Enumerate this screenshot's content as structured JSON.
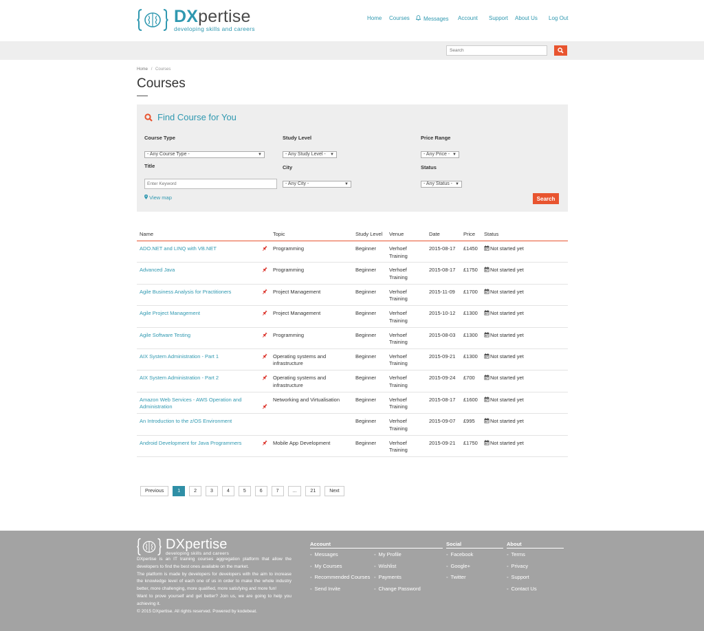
{
  "brand": {
    "name_prefix": "DX",
    "name_rest": "pertise",
    "tagline": "developing skills and careers"
  },
  "nav": {
    "home": "Home",
    "courses": "Courses",
    "messages": "Messages",
    "account": "Account",
    "support": "Support",
    "about": "About Us",
    "logout": "Log Out"
  },
  "search": {
    "placeholder": "Search"
  },
  "breadcrumb": {
    "home": "Home",
    "sep": "/",
    "current": "Courses"
  },
  "page_title": "Courses",
  "finder": {
    "title": "Find Course for You",
    "course_type_label": "Course Type",
    "course_type_value": "- Any Course Type -",
    "study_level_label": "Study Level",
    "study_level_value": "- Any Study Level -",
    "price_label": "Price Range",
    "price_value": "- Any Price -",
    "title_label": "Title",
    "keyword_placeholder": "Enter Keyword",
    "city_label": "City",
    "city_value": "- Any City -",
    "status_label": "Status",
    "status_value": "- Any Status -",
    "view_map": "View map",
    "search_button": "Search"
  },
  "table": {
    "headers": {
      "name": "Name",
      "topic": "Topic",
      "level": "Study Level",
      "venue": "Venue",
      "date": "Date",
      "price": "Price",
      "status": "Status"
    },
    "rows": [
      {
        "name": "ADO.NET and LINQ with VB.NET",
        "topic": "Programming",
        "level": "Beginner",
        "venue": "Verhoef Training",
        "date": "2015-08-17",
        "price": "£1450",
        "status": "Not started yet",
        "pin": true
      },
      {
        "name": "Advanced Java",
        "topic": "Programming",
        "level": "Beginner",
        "venue": "Verhoef Training",
        "date": "2015-08-17",
        "price": "£1750",
        "status": "Not started yet",
        "pin": true
      },
      {
        "name": "Agile Business Analysis for Practitioners",
        "topic": "Project Management",
        "level": "Beginner",
        "venue": "Verhoef Training",
        "date": "2015-11-09",
        "price": "£1700",
        "status": "Not started yet",
        "pin": true
      },
      {
        "name": "Agile Project Management",
        "topic": "Project Management",
        "level": "Beginner",
        "venue": "Verhoef Training",
        "date": "2015-10-12",
        "price": "£1300",
        "status": "Not started yet",
        "pin": true
      },
      {
        "name": "Agile Software Testing",
        "topic": "Programming",
        "level": "Beginner",
        "venue": "Verhoef Training",
        "date": "2015-08-03",
        "price": "£1300",
        "status": "Not started yet",
        "pin": true
      },
      {
        "name": "AIX System Administration - Part 1",
        "topic": "Operating systems and infrastructure",
        "level": "Beginner",
        "venue": "Verhoef Training",
        "date": "2015-09-21",
        "price": "£1300",
        "status": "Not started yet",
        "pin": true
      },
      {
        "name": "AIX System Administration - Part 2",
        "topic": "Operating systems and infrastructure",
        "level": "Beginner",
        "venue": "Verhoef Training",
        "date": "2015-09-24",
        "price": "£700",
        "status": "Not started yet",
        "pin": true
      },
      {
        "name": "Amazon Web Services - AWS Operation and Administration",
        "topic": "Networking and Virtualisation",
        "level": "Beginner",
        "venue": "Verhoef Training",
        "date": "2015-08-17",
        "price": "£1600",
        "status": "Not started yet",
        "pin": true
      },
      {
        "name": "An Introduction to the z/OS Environment",
        "topic": "",
        "level": "Beginner",
        "venue": "Verhoef Training",
        "date": "2015-09-07",
        "price": "£995",
        "status": "Not started yet",
        "pin": false
      },
      {
        "name": "Android Development for Java Programmers",
        "topic": "Mobile App Development",
        "level": "Beginner",
        "venue": "Verhoef Training",
        "date": "2015-09-21",
        "price": "£1750",
        "status": "Not started yet",
        "pin": true
      }
    ]
  },
  "pagination": {
    "previous": "Previous",
    "pages": [
      "1",
      "2",
      "3",
      "4",
      "5",
      "6",
      "7",
      "...",
      "21"
    ],
    "active": "1",
    "next": "Next"
  },
  "footer": {
    "about_paragraphs": [
      "DXpertise is an IT training courses aggregation platform that allow the developers to find the best ones available on the market.",
      "The platform is made by developers for developers with the aim to increase the knowledge level of each one of us in order to make the whole industry better, more challenging, more qualified, more satisfying and more fun!",
      "Want to prove yourself and get better? Join us, we are going to help you achieving it.",
      "© 2015 DXpertise. All rights reserved. Powered by kodebeat."
    ],
    "account_title": "Account",
    "account_links_col1": [
      "Messages",
      "My Courses",
      "Recommended Courses",
      "Send Invite"
    ],
    "account_links_col2": [
      "My Profile",
      "Wishlist",
      "Payments",
      "Change Password"
    ],
    "social_title": "Social",
    "social_links": [
      "Facebook",
      "Google+",
      "Twitter"
    ],
    "about_title": "About",
    "about_links": [
      "Terms",
      "Privacy",
      "Support",
      "Contact Us"
    ]
  },
  "colors": {
    "accent_teal": "#2f98b0",
    "accent_orange": "#e8542f",
    "footer_bg": "#a3a3a3",
    "panel_bg": "#eeeeee"
  },
  "icons": {
    "logo": "brain-brackets-icon",
    "messages": "bell-icon",
    "search": "magnifier-icon",
    "map": "map-marker-icon",
    "row_pin": "pushpin-icon",
    "status": "calendar-icon"
  }
}
